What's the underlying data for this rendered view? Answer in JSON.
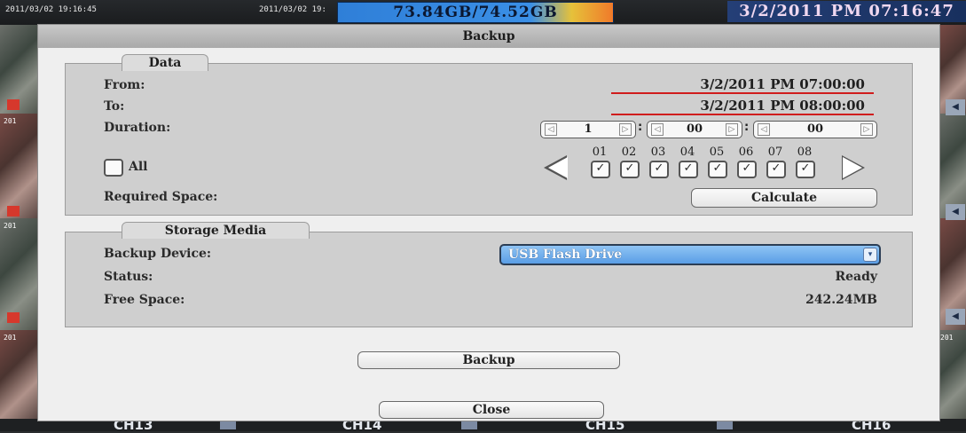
{
  "background": {
    "timestamp_left": "2011/03/02 19:16:45",
    "timestamp_mid": "2011/03/02 19:",
    "disk_usage": "73.84GB/74.52GB",
    "clock": "3/2/2011 PM 07:16:47",
    "cam_labels": [
      "201",
      "201",
      "201",
      "201"
    ],
    "channels": [
      "CH13",
      "CH14",
      "CH15",
      "CH16"
    ]
  },
  "dialog": {
    "title": "Backup",
    "data_group": {
      "tab_label": "Data",
      "from_label": "From:",
      "from_value": "3/2/2011 PM 07:00:00",
      "to_label": "To:",
      "to_value": "3/2/2011 PM 08:00:00",
      "duration_label": "Duration:",
      "duration": {
        "hours": "1",
        "minutes": "00",
        "seconds": "00"
      },
      "all_label": "All",
      "all_checked": false,
      "channels": [
        {
          "num": "01",
          "checked": true
        },
        {
          "num": "02",
          "checked": true
        },
        {
          "num": "03",
          "checked": true
        },
        {
          "num": "04",
          "checked": true
        },
        {
          "num": "05",
          "checked": true
        },
        {
          "num": "06",
          "checked": true
        },
        {
          "num": "07",
          "checked": true
        },
        {
          "num": "08",
          "checked": true
        }
      ],
      "required_space_label": "Required Space:",
      "calculate_button": "Calculate"
    },
    "storage_group": {
      "tab_label": "Storage Media",
      "device_label": "Backup Device:",
      "device_value": "USB Flash Drive",
      "status_label": "Status:",
      "status_value": "Ready",
      "free_space_label": "Free Space:",
      "free_space_value": "242.24MB"
    },
    "backup_button": "Backup",
    "close_button": "Close"
  },
  "colors": {
    "dialog_bg": "#efefef",
    "group_bg": "#cfcfcf",
    "accent_red": "#d01d1d",
    "select_blue": "#5a9ee6"
  }
}
